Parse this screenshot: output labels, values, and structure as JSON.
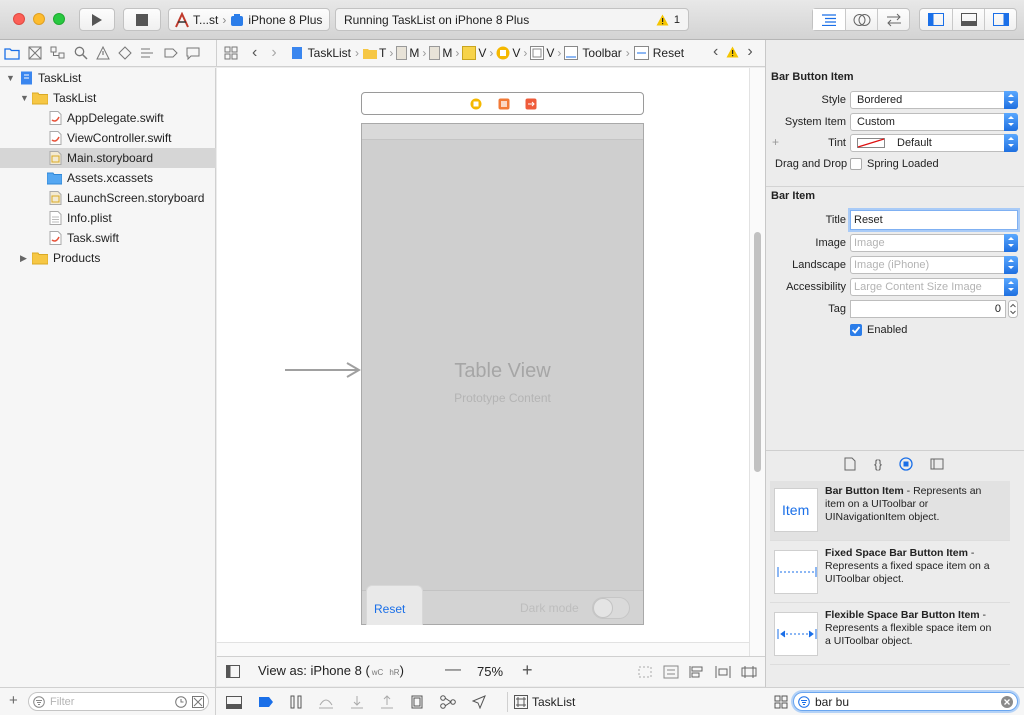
{
  "toolbar": {
    "scheme_target": "T...st",
    "device": "iPhone 8 Plus",
    "status": "Running TaskList on iPhone 8 Plus",
    "warning_count": "1"
  },
  "jump_bar": {
    "project": "TaskList",
    "crumb_1": "T",
    "crumb_2": "M",
    "crumb_3": "M",
    "crumb_4": "V",
    "crumb_5": "V",
    "crumb_6": "V",
    "toolbar_crumb": "Toolbar",
    "selected": "Reset"
  },
  "navigator": {
    "items": [
      {
        "label": "TaskList",
        "type": "project",
        "depth": 0
      },
      {
        "label": "TaskList",
        "type": "folder",
        "depth": 1
      },
      {
        "label": "AppDelegate.swift",
        "type": "swift",
        "depth": 2
      },
      {
        "label": "ViewController.swift",
        "type": "swift",
        "depth": 2
      },
      {
        "label": "Main.storyboard",
        "type": "storyboard",
        "depth": 2,
        "selected": true
      },
      {
        "label": "Assets.xcassets",
        "type": "assets",
        "depth": 2
      },
      {
        "label": "LaunchScreen.storyboard",
        "type": "storyboard",
        "depth": 2
      },
      {
        "label": "Info.plist",
        "type": "plist",
        "depth": 2
      },
      {
        "label": "Task.swift",
        "type": "swift",
        "depth": 2
      },
      {
        "label": "Products",
        "type": "folder",
        "depth": 1
      }
    ],
    "filter_placeholder": "Filter"
  },
  "canvas": {
    "table_view_title": "Table View",
    "table_view_subtitle": "Prototype Content",
    "toolbar_button": "Reset",
    "dark_mode_label": "Dark mode",
    "view_as": "View as: iPhone 8 (",
    "size_class_w": "wC",
    "size_class_h": "hR",
    "view_as_close": ")",
    "zoom": "75%"
  },
  "inspector": {
    "section_bar_button_item": "Bar Button Item",
    "style_label": "Style",
    "style_value": "Bordered",
    "system_item_label": "System Item",
    "system_item_value": "Custom",
    "tint_label": "Tint",
    "tint_value": "Default",
    "drag_drop_label": "Drag and Drop",
    "spring_loaded_label": "Spring Loaded",
    "section_bar_item": "Bar Item",
    "title_label": "Title",
    "title_value": "Reset",
    "image_label": "Image",
    "image_placeholder": "Image",
    "landscape_label": "Landscape",
    "landscape_placeholder": "Image (iPhone)",
    "accessibility_label": "Accessibility",
    "accessibility_placeholder": "Large Content Size Image",
    "tag_label": "Tag",
    "tag_value": "0",
    "enabled_label": "Enabled"
  },
  "library": {
    "items": [
      {
        "thumb": "Item",
        "title": "Bar Button Item",
        "desc": " - Represents an item on a UIToolbar or UINavigationItem object."
      },
      {
        "title": "Fixed Space Bar Button Item",
        "desc": " - Represents a fixed space item on a UIToolbar object."
      },
      {
        "title": "Flexible Space Bar Button Item",
        "desc": " - Represents a flexible space item on a UIToolbar object."
      }
    ],
    "search_value": "bar bu"
  },
  "debug": {
    "process": "TaskList"
  },
  "colors": {
    "accent": "#1a6fe8",
    "warning": "#f5c500",
    "selection": "#d6d6d6"
  }
}
